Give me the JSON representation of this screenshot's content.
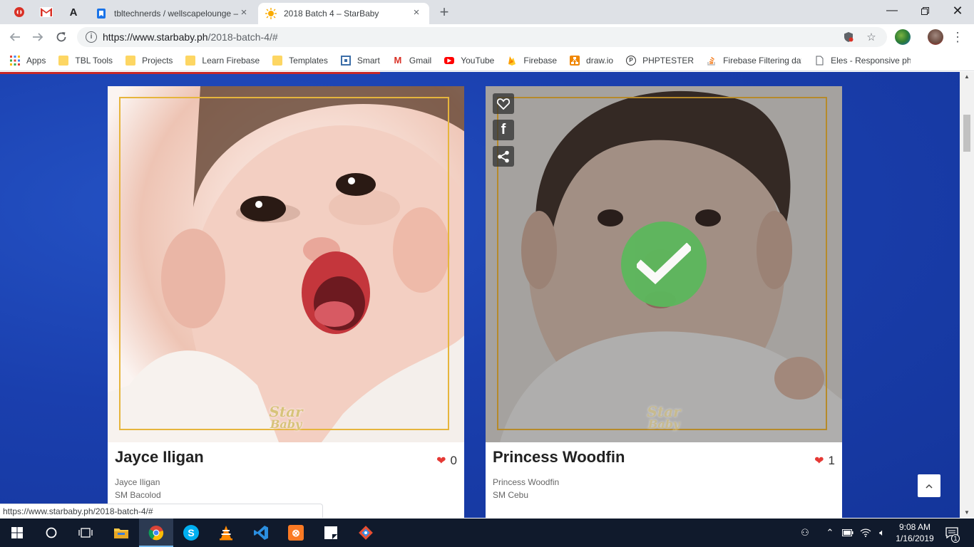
{
  "browser": {
    "tabs": [
      {
        "title": "tbltechnerds / wellscapelounge –",
        "active": false
      },
      {
        "title": "2018 Batch 4 – StarBaby",
        "active": true
      }
    ],
    "url_host": "https://www.starbaby.ph",
    "url_path": "/2018-batch-4/#"
  },
  "bookmarks": [
    {
      "label": "Apps",
      "icon": "apps-grid-icon"
    },
    {
      "label": "TBL Tools",
      "icon": "folder-icon"
    },
    {
      "label": "Projects",
      "icon": "folder-icon"
    },
    {
      "label": "Learn Firebase",
      "icon": "folder-icon"
    },
    {
      "label": "Templates",
      "icon": "folder-icon"
    },
    {
      "label": "Smart",
      "icon": "smart-icon"
    },
    {
      "label": "Gmail",
      "icon": "gmail-icon"
    },
    {
      "label": "YouTube",
      "icon": "youtube-icon"
    },
    {
      "label": "Firebase",
      "icon": "firebase-icon"
    },
    {
      "label": "draw.io",
      "icon": "drawio-icon"
    },
    {
      "label": "PHPTESTER",
      "icon": "phptester-icon"
    },
    {
      "label": "Firebase Filtering dat",
      "icon": "stackoverflow-icon"
    },
    {
      "label": "Eles - Responsive php",
      "icon": "page-icon"
    }
  ],
  "cards": [
    {
      "name": "Jayce Iligan",
      "likes": "0",
      "subname": "Jayce Iligan",
      "location": "SM Bacolod",
      "watermark_1": "Star",
      "watermark_2": "Baby"
    },
    {
      "name": "Princess Woodfin",
      "likes": "1",
      "subname": "Princess Woodfin",
      "location": "SM Cebu",
      "watermark_1": "Star",
      "watermark_2": "Baby"
    }
  ],
  "status_url": "https://www.starbaby.ph/2018-batch-4/#",
  "taskbar": {
    "time": "9:08 AM",
    "date": "1/16/2019",
    "notifications": "1"
  },
  "colors": {
    "page_bg": "#1a3fae",
    "frame_gold": "#e6b53c",
    "check_green": "#5cb85c",
    "heart_red": "#e53935"
  }
}
